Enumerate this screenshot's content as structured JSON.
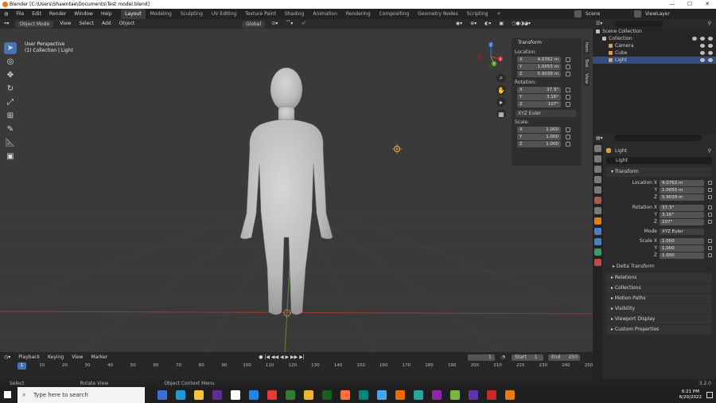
{
  "titlebar": {
    "title": "Blender [C:\\Users\\Shawntae\\Documents\\Test model.blend]",
    "controls": [
      "—",
      "☐",
      "✕"
    ]
  },
  "menu": [
    "File",
    "Edit",
    "Render",
    "Window",
    "Help"
  ],
  "workspaces": [
    "Layout",
    "Modeling",
    "Sculpting",
    "UV Editing",
    "Texture Paint",
    "Shading",
    "Animation",
    "Rendering",
    "Compositing",
    "Geometry Nodes",
    "Scripting"
  ],
  "workspace_add": "+",
  "top_right": {
    "scene": "Scene",
    "view_layer": "ViewLayer"
  },
  "viewport_header": {
    "mode": "Object Mode",
    "menus": [
      "View",
      "Select",
      "Add",
      "Object"
    ],
    "orientation": "Global",
    "options": "Options"
  },
  "viewport": {
    "perspective": "User Perspective",
    "collection": "(1) Collection | Light"
  },
  "npanel": {
    "title": "Transform",
    "location_label": "Location:",
    "rotation_label": "Rotation:",
    "scale_label": "Scale:",
    "location": [
      {
        "axis": "X",
        "value": "4.0762 m"
      },
      {
        "axis": "Y",
        "value": "1.0055 m"
      },
      {
        "axis": "Z",
        "value": "5.9039 m"
      }
    ],
    "rotation": [
      {
        "axis": "X",
        "value": "37.3°"
      },
      {
        "axis": "Y",
        "value": "3.16°"
      },
      {
        "axis": "Z",
        "value": "107°"
      }
    ],
    "rotation_mode": "XYZ Euler",
    "scale": [
      {
        "axis": "X",
        "value": "1.000"
      },
      {
        "axis": "Y",
        "value": "1.000"
      },
      {
        "axis": "Z",
        "value": "1.000"
      }
    ],
    "tabs": [
      "Item",
      "Tool",
      "View"
    ]
  },
  "gizmo_axes": {
    "x": "X",
    "y": "Y",
    "z": "Z"
  },
  "timeline": {
    "menus": [
      "Playback",
      "Keying",
      "View",
      "Marker"
    ],
    "current_frame": "1",
    "start_label": "Start",
    "start_value": "1",
    "end_label": "End",
    "end_value": "250",
    "ticks": [
      "1",
      "10",
      "20",
      "30",
      "40",
      "50",
      "60",
      "70",
      "80",
      "90",
      "100",
      "110",
      "120",
      "130",
      "140",
      "150",
      "160",
      "170",
      "180",
      "190",
      "200",
      "210",
      "220",
      "230",
      "240",
      "250"
    ],
    "playhead": "1"
  },
  "statusbar": {
    "select": "Select",
    "rotate": "Rotate View",
    "context": "Object Context Menu",
    "version": "3.2.0"
  },
  "outliner": {
    "root": "Scene Collection",
    "items": [
      {
        "name": "Collection",
        "color": "#bdbdbd",
        "active": false
      },
      {
        "name": "Camera",
        "color": "#67a6d1",
        "active": false
      },
      {
        "name": "Cube",
        "color": "#e29f3c",
        "active": false
      },
      {
        "name": "Light",
        "color": "#e29f3c",
        "active": true
      }
    ]
  },
  "properties": {
    "object_name": "Light",
    "object_field": "Light",
    "transform_section": "Transform",
    "location_label": "Location X",
    "location": [
      "4.0762 m",
      "1.0055 m",
      "5.9039 m"
    ],
    "rotation_label": "Rotation X",
    "rotation": [
      "37.3°",
      "3.16°",
      "107°"
    ],
    "mode_label": "Mode",
    "mode_value": "XYZ Euler",
    "scale_label": "Scale X",
    "scale": [
      "1.000",
      "1.000",
      "1.000"
    ],
    "axis_labels": [
      "Y",
      "Z"
    ],
    "sections": [
      "Delta Transform",
      "Relations",
      "Collections",
      "Motion Paths",
      "Visibility",
      "Viewport Display",
      "Custom Properties"
    ]
  },
  "taskbar": {
    "search_placeholder": "Type here to search",
    "time": "6:21 PM",
    "date": "6/20/2022",
    "icon_colors": [
      "#3a6fd8",
      "#1f9ad6",
      "#f5c242",
      "#5c2d91",
      "#ffffff",
      "#1e88e5",
      "#e53935",
      "#2e7d32",
      "#f0b429",
      "#1b5e20",
      "#ff7043",
      "#00897b",
      "#42a5f5",
      "#ef6c00",
      "#26a69a",
      "#8e24aa",
      "#7cb342",
      "#5e35b1",
      "#c62828",
      "#e87d0d"
    ]
  }
}
